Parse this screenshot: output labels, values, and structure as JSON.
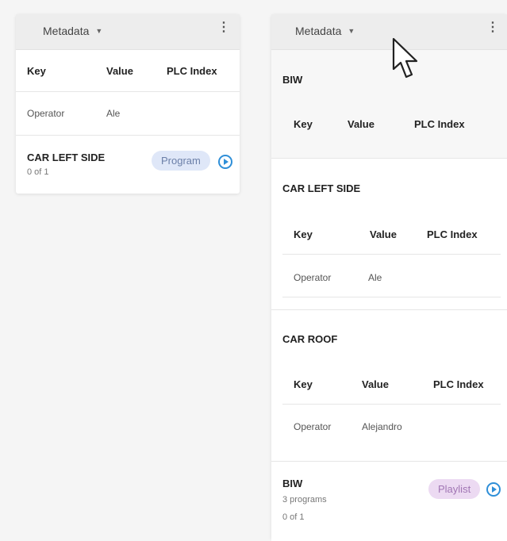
{
  "left_panel": {
    "dropdown_label": "Metadata",
    "columns": [
      "Key",
      "Value",
      "PLC Index"
    ],
    "rows": [
      {
        "key": "Operator",
        "value": "Ale"
      }
    ],
    "item": {
      "title": "CAR LEFT SIDE",
      "subtitle": "0 of 1",
      "badge": "Program"
    }
  },
  "right_panel": {
    "dropdown_label": "Metadata",
    "groups": [
      {
        "title": "BIW",
        "columns": [
          "Key",
          "Value",
          "PLC Index"
        ],
        "rows": []
      },
      {
        "title": "CAR LEFT SIDE",
        "columns": [
          "Key",
          "Value",
          "PLC Index"
        ],
        "rows": [
          {
            "key": "Operator",
            "value": "Ale"
          }
        ]
      },
      {
        "title": "CAR ROOF",
        "columns": [
          "Key",
          "Value",
          "PLC Index"
        ],
        "rows": [
          {
            "key": "Operator",
            "value": "Alejandro"
          }
        ]
      }
    ],
    "item": {
      "title": "BIW",
      "subtitle1": "3 programs",
      "subtitle2": "0 of 1",
      "badge": "Playlist"
    }
  },
  "icons": {
    "caret": "caret-down-icon",
    "more": "more-vertical-icon",
    "play": "play-circle-icon",
    "cursor": "mouse-pointer-icon"
  },
  "colors": {
    "accent": "#2f8fd8",
    "program_badge_bg": "#dfe7f8",
    "playlist_badge_bg": "#ecdaf2"
  }
}
